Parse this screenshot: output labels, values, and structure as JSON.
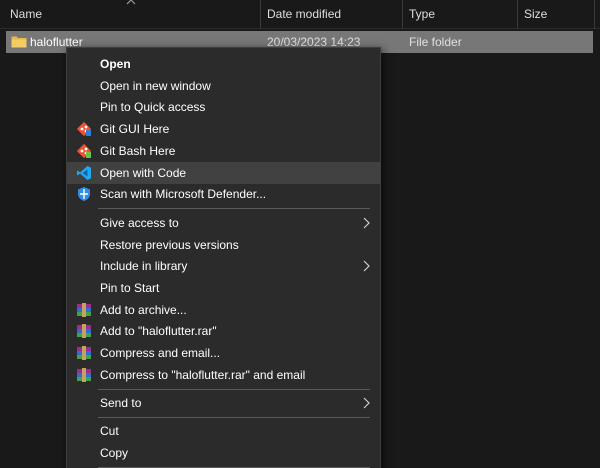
{
  "columns": {
    "name": "Name",
    "date_modified": "Date modified",
    "type": "Type",
    "size": "Size"
  },
  "file": {
    "name": "haloflutter",
    "date": "20/03/2023 14:23",
    "type": "File folder"
  },
  "menu": {
    "open": "Open",
    "open_new_window": "Open in new window",
    "pin_quick_access": "Pin to Quick access",
    "git_gui": "Git GUI Here",
    "git_bash": "Git Bash Here",
    "open_with_code": "Open with Code",
    "scan_defender": "Scan with Microsoft Defender...",
    "give_access": "Give access to",
    "restore_versions": "Restore previous versions",
    "include_library": "Include in library",
    "pin_start": "Pin to Start",
    "add_archive": "Add to archive...",
    "add_rar": "Add to \"haloflutter.rar\"",
    "compress_email": "Compress and email...",
    "compress_rar_email": "Compress to \"haloflutter.rar\" and email",
    "send_to": "Send to",
    "cut": "Cut",
    "copy": "Copy"
  },
  "icons": {
    "folder": "folder-icon",
    "git": "git-icon",
    "vscode": "vscode-icon",
    "defender": "defender-shield-icon",
    "winrar": "winrar-icon",
    "submenu": "chevron-right-icon"
  },
  "colors": {
    "background": "#191919",
    "menu_background": "#2b2b2b",
    "selection": "#777777",
    "hover": "#414141",
    "folder": "#e8b84a",
    "git": "#f05133",
    "vscode": "#23a9f2"
  }
}
